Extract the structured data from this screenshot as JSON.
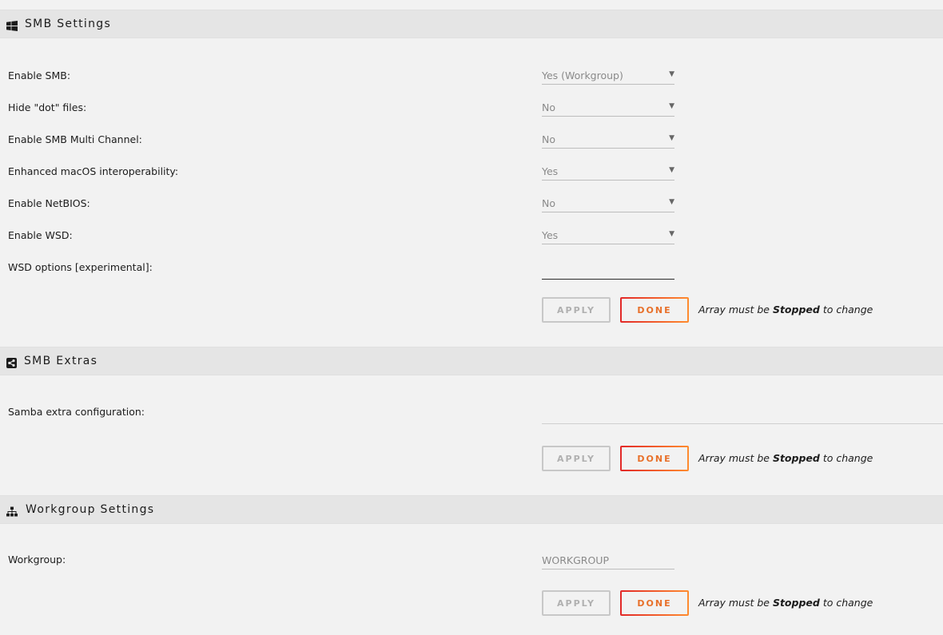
{
  "smb_settings": {
    "title": "SMB Settings",
    "icon": "windows-icon",
    "fields": [
      {
        "label": "Enable SMB:",
        "value": "Yes (Workgroup)"
      },
      {
        "label": "Hide \"dot\" files:",
        "value": "No"
      },
      {
        "label": "Enable SMB Multi Channel:",
        "value": "No"
      },
      {
        "label": "Enhanced macOS interoperability:",
        "value": "Yes"
      },
      {
        "label": "Enable NetBIOS:",
        "value": "No"
      },
      {
        "label": "Enable WSD:",
        "value": "Yes"
      }
    ],
    "wsd_options_label": "WSD options [experimental]:",
    "wsd_options_value": ""
  },
  "smb_extras": {
    "title": "SMB Extras",
    "icon": "share-icon",
    "samba_extra_label": "Samba extra configuration:",
    "samba_extra_value": ""
  },
  "workgroup_settings": {
    "title": "Workgroup Settings",
    "icon": "sitemap-icon",
    "workgroup_label": "Workgroup:",
    "workgroup_value": "WORKGROUP"
  },
  "buttons": {
    "apply": "APPLY",
    "done": "DONE"
  },
  "note": {
    "prefix": "Array must be ",
    "bold": "Stopped",
    "suffix": " to change"
  },
  "colors": {
    "done_gradient_start": "#e22828",
    "done_gradient_end": "#ff8c2f",
    "header_bg": "#e5e5e5",
    "page_bg": "#f2f2f2"
  }
}
